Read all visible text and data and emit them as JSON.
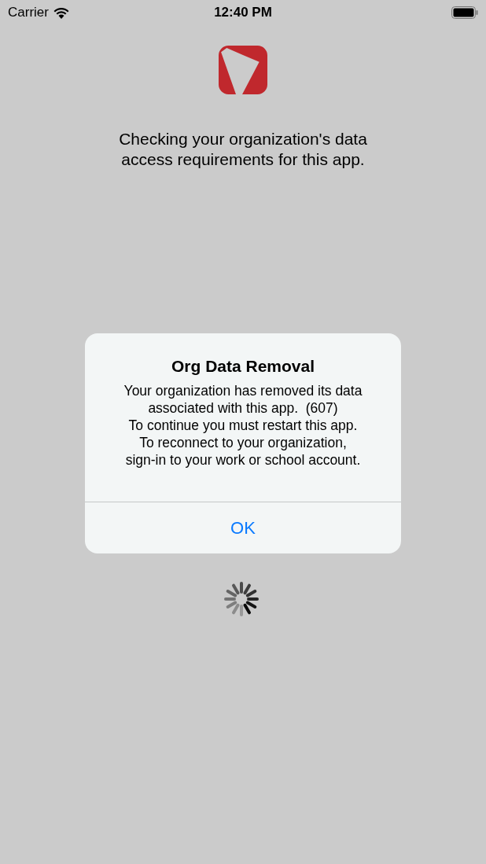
{
  "status_bar": {
    "carrier": "Carrier",
    "time": "12:40 PM"
  },
  "message": "Checking your organization's data access requirements for this app.",
  "alert": {
    "title": "Org Data Removal",
    "lines": [
      "Your organization has removed its data",
      "associated with this app.  (607)",
      "To continue you must restart this app.",
      "To reconnect to your organization,",
      "sign-in to your work or school account."
    ],
    "buttons": [
      "OK"
    ]
  }
}
